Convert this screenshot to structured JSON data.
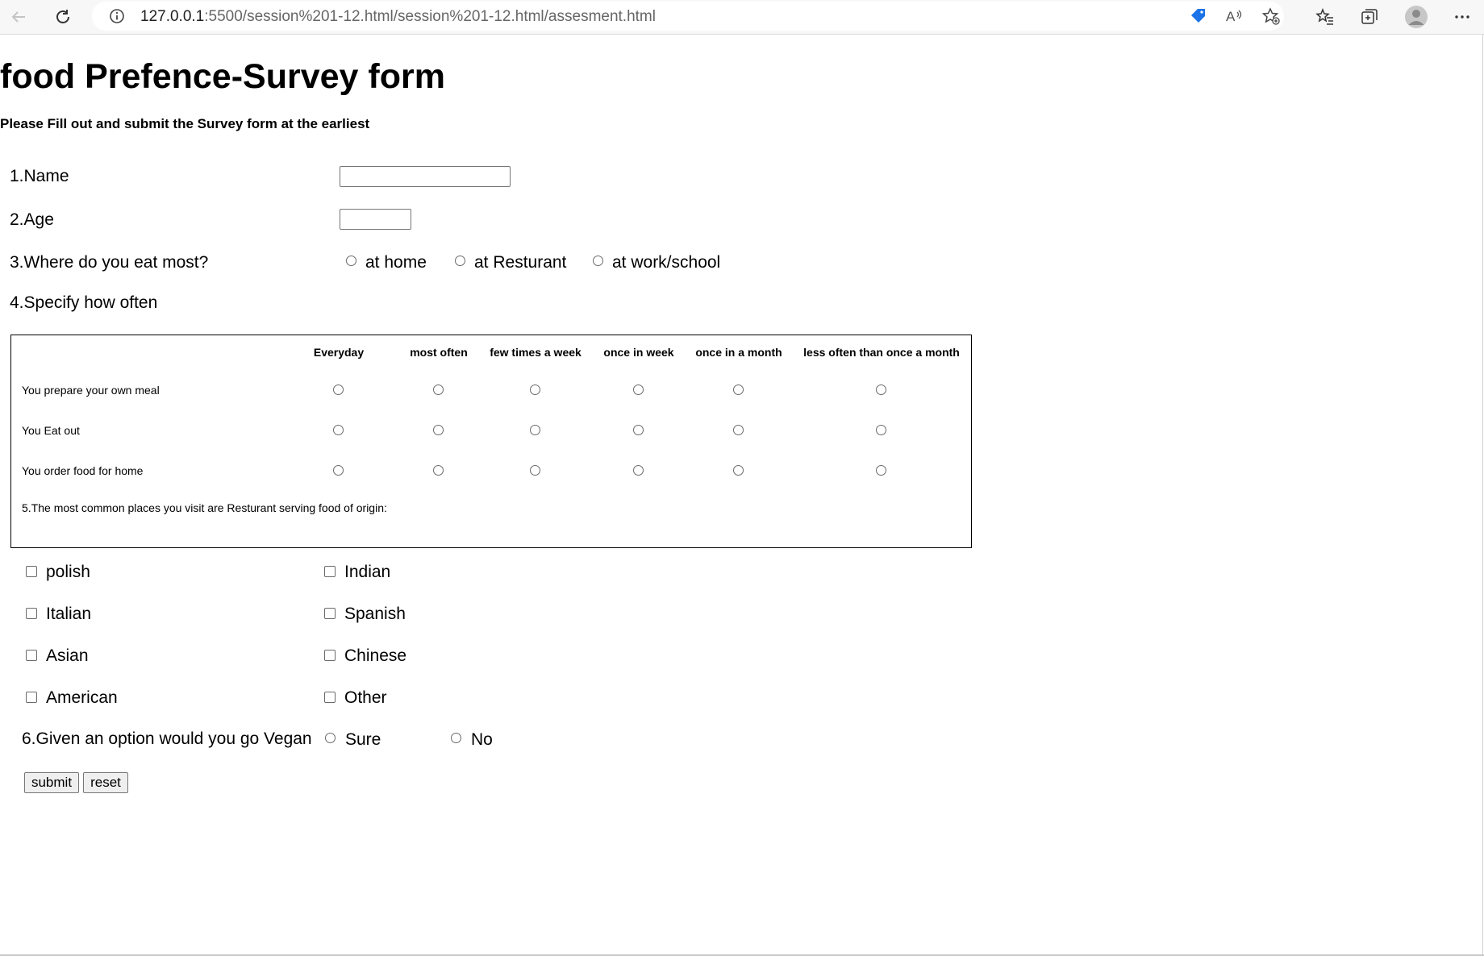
{
  "browser": {
    "url_host": "127.0.0.1",
    "url_rest": ":5500/session%201-12.html/session%201-12.html/assesment.html"
  },
  "page": {
    "title": "food Prefence-Survey form",
    "subtitle": "Please Fill out and submit the Survey form at the earliest"
  },
  "q1": {
    "label": "1.Name",
    "value": ""
  },
  "q2": {
    "label": "2.Age",
    "value": ""
  },
  "q3": {
    "label": "3.Where do you eat most?",
    "options": [
      "at home",
      "at Resturant",
      "at work/school"
    ]
  },
  "q4": {
    "label": "4.Specify how often",
    "columns": [
      "Everyday",
      "most often",
      "few times a week",
      "once in week",
      "once in a month",
      "less often than once a month"
    ],
    "rows": [
      "You prepare your own meal",
      "You Eat out",
      "You order food for home"
    ]
  },
  "q5": {
    "label": "5.The most common places you visit are Resturant serving food of origin:",
    "options": [
      "polish",
      "Indian",
      "Italian",
      "Spanish",
      "Asian",
      "Chinese",
      "American",
      "Other"
    ]
  },
  "q6": {
    "label": "6.Given an option would you go Vegan",
    "options": [
      "Sure",
      "No"
    ]
  },
  "buttons": {
    "submit": "submit",
    "reset": "reset"
  }
}
